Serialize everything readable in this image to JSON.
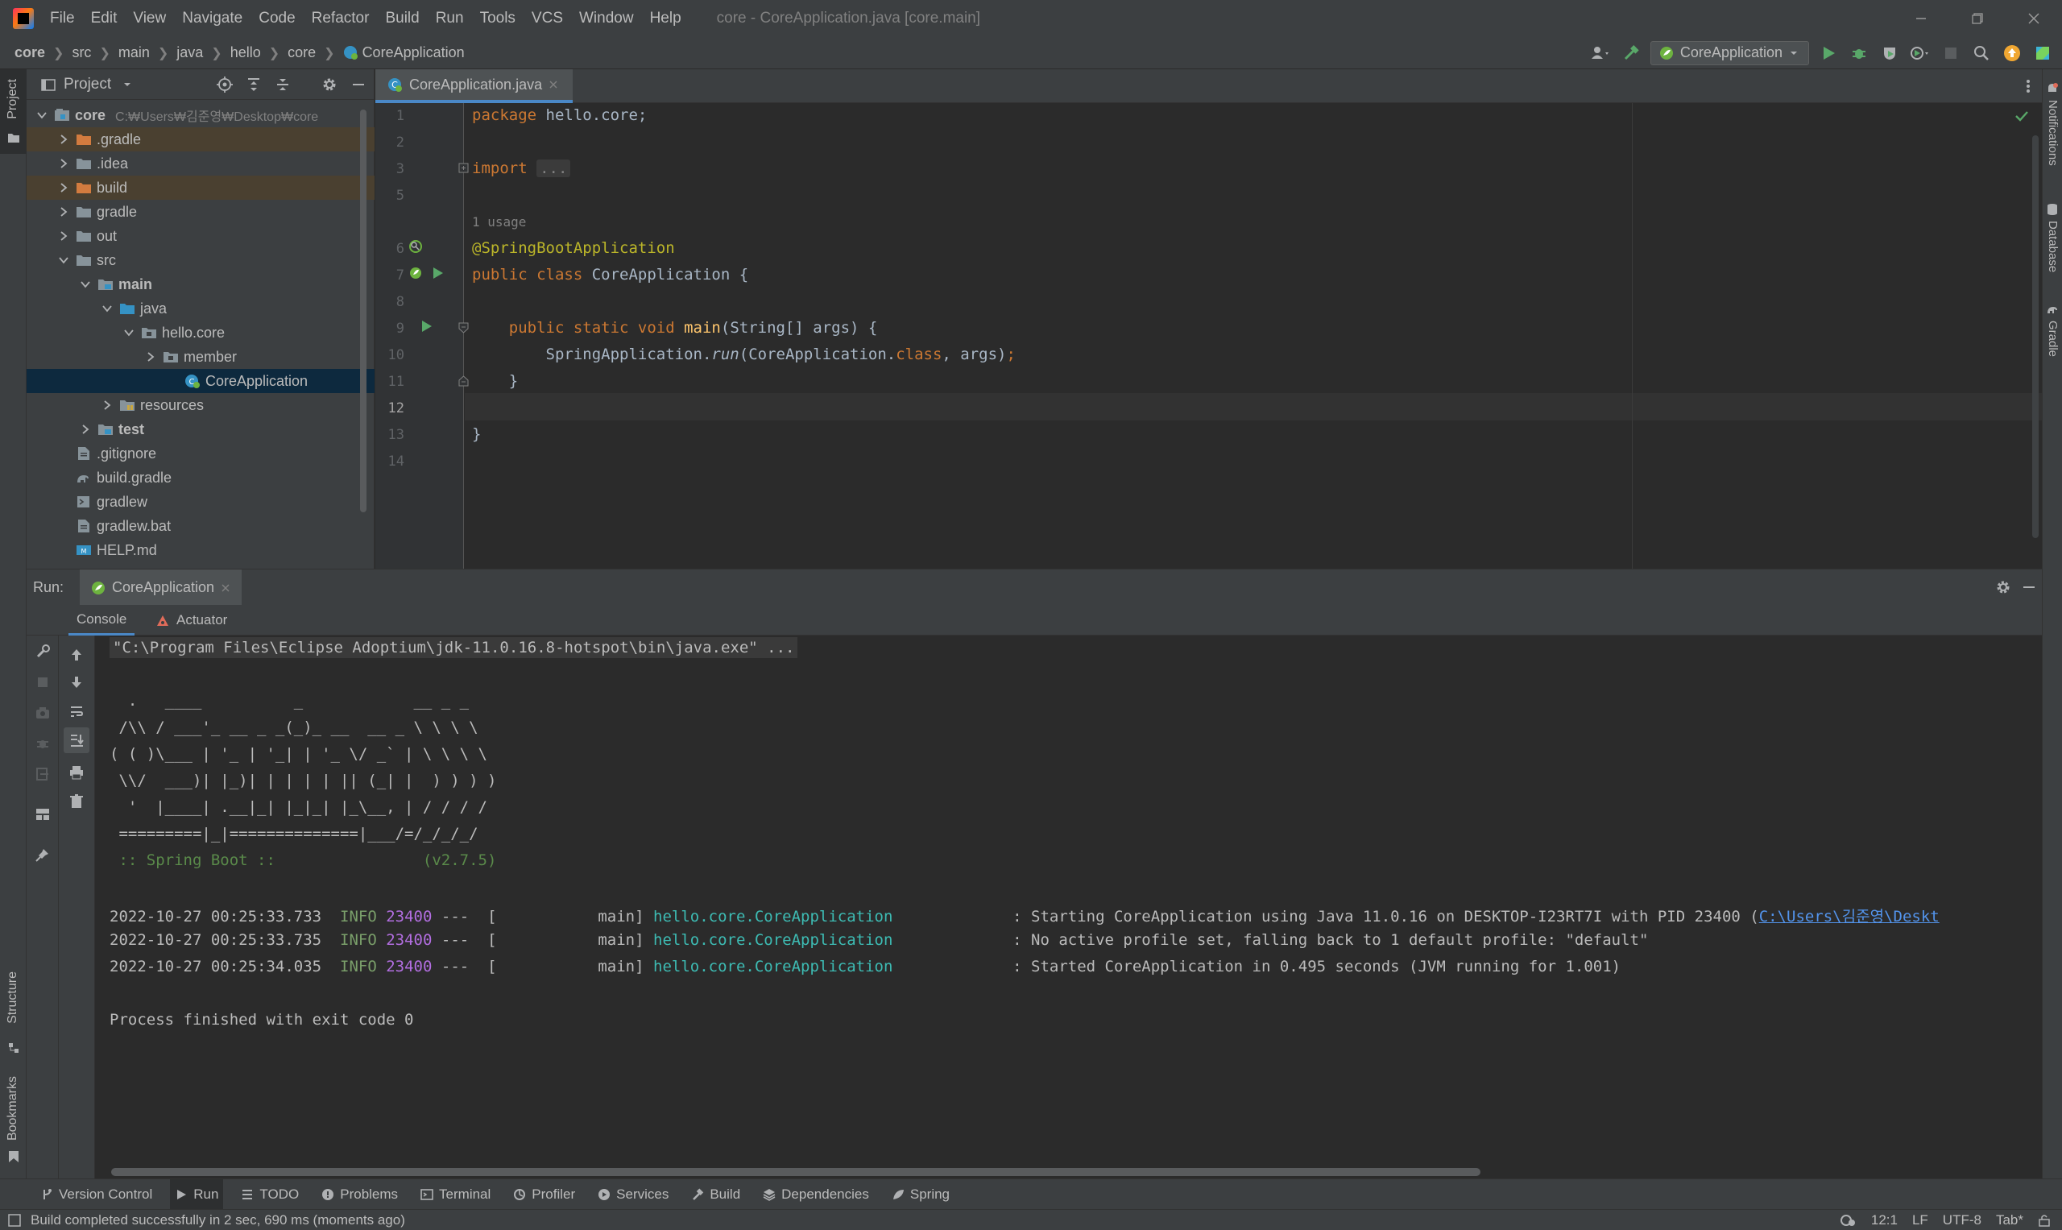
{
  "menubar": {
    "items": [
      "File",
      "Edit",
      "View",
      "Navigate",
      "Code",
      "Refactor",
      "Build",
      "Run",
      "Tools",
      "VCS",
      "Window",
      "Help"
    ],
    "window_title": "core - CoreApplication.java [core.main]"
  },
  "breadcrumb": [
    "core",
    "src",
    "main",
    "java",
    "hello",
    "core",
    "CoreApplication"
  ],
  "toolbar": {
    "run_config": "CoreApplication"
  },
  "project_panel": {
    "title": "Project",
    "tree": [
      {
        "label": "core",
        "path": "C:₩Users₩김준영₩Desktop₩core",
        "depth": 0,
        "type": "module",
        "expanded": true,
        "bold": true
      },
      {
        "label": ".gradle",
        "depth": 1,
        "type": "folder-orange",
        "expanded": false,
        "hl": true
      },
      {
        "label": ".idea",
        "depth": 1,
        "type": "folder",
        "expanded": false
      },
      {
        "label": "build",
        "depth": 1,
        "type": "folder-orange",
        "expanded": false,
        "hl": true
      },
      {
        "label": "gradle",
        "depth": 1,
        "type": "folder",
        "expanded": false
      },
      {
        "label": "out",
        "depth": 1,
        "type": "folder",
        "expanded": false
      },
      {
        "label": "src",
        "depth": 1,
        "type": "folder",
        "expanded": true
      },
      {
        "label": "main",
        "depth": 2,
        "type": "folder-src",
        "expanded": true,
        "bold": true
      },
      {
        "label": "java",
        "depth": 3,
        "type": "folder-blue",
        "expanded": true
      },
      {
        "label": "hello.core",
        "depth": 4,
        "type": "package",
        "expanded": true
      },
      {
        "label": "member",
        "depth": 5,
        "type": "package",
        "expanded": false
      },
      {
        "label": "CoreApplication",
        "depth": 6,
        "type": "spring-class",
        "selected": true
      },
      {
        "label": "resources",
        "depth": 3,
        "type": "folder-res",
        "expanded": false
      },
      {
        "label": "test",
        "depth": 2,
        "type": "folder-src",
        "expanded": false,
        "bold": true
      },
      {
        "label": ".gitignore",
        "depth": 1,
        "type": "file"
      },
      {
        "label": "build.gradle",
        "depth": 1,
        "type": "gradle"
      },
      {
        "label": "gradlew",
        "depth": 1,
        "type": "file-exec"
      },
      {
        "label": "gradlew.bat",
        "depth": 1,
        "type": "file"
      },
      {
        "label": "HELP.md",
        "depth": 1,
        "type": "md"
      }
    ]
  },
  "editor": {
    "tab_label": "CoreApplication.java",
    "line_numbers": [
      "1",
      "2",
      "3",
      "5",
      "6",
      "7",
      "8",
      "9",
      "10",
      "11",
      "12",
      "13",
      "14"
    ],
    "usage_hint": "1 usage",
    "current_line": "12"
  },
  "run_panel": {
    "label": "Run:",
    "tab": "CoreApplication",
    "subtabs": [
      "Console",
      "Actuator"
    ],
    "command": "\"C:\\Program Files\\Eclipse Adoptium\\jdk-11.0.16.8-hotspot\\bin\\java.exe\" ...",
    "banner": [
      "  .   ____          _            __ _ _",
      " /\\\\ / ___'_ __ _ _(_)_ __  __ _ \\ \\ \\ \\",
      "( ( )\\___ | '_ | '_| | '_ \\/ _` | \\ \\ \\ \\",
      " \\\\/  ___)| |_)| | | | | || (_| |  ) ) ) )",
      "  '  |____| .__|_| |_|_| |_\\__, | / / / /",
      " =========|_|==============|___/=/_/_/_/"
    ],
    "spring_line": " :: Spring Boot ::                (v2.7.5)",
    "logs": [
      {
        "ts": "2022-10-27 00:25:33.733",
        "level": "INFO",
        "pid": "23400",
        "thread": "---  [           main]",
        "logger": "hello.core.CoreApplication",
        "msg": ": Starting CoreApplication using Java 11.0.16 on DESKTOP-I23RT7I with PID 23400 (",
        "link": "C:\\Users\\김준영\\Deskt"
      },
      {
        "ts": "2022-10-27 00:25:33.735",
        "level": "INFO",
        "pid": "23400",
        "thread": "---  [           main]",
        "logger": "hello.core.CoreApplication",
        "msg": ": No active profile set, falling back to 1 default profile: \"default\"",
        "link": ""
      },
      {
        "ts": "2022-10-27 00:25:34.035",
        "level": "INFO",
        "pid": "23400",
        "thread": "---  [           main]",
        "logger": "hello.core.CoreApplication",
        "msg": ": Started CoreApplication in 0.495 seconds (JVM running for 1.001)",
        "link": ""
      }
    ],
    "exit": "Process finished with exit code 0"
  },
  "bottom_tools": [
    "Version Control",
    "Run",
    "TODO",
    "Problems",
    "Terminal",
    "Profiler",
    "Services",
    "Build",
    "Dependencies",
    "Spring"
  ],
  "left_stripe": {
    "top": "Project",
    "structure": "Structure",
    "bookmarks": "Bookmarks"
  },
  "right_stripe": [
    "Notifications",
    "Database",
    "Gradle"
  ],
  "status": {
    "message": "Build completed successfully in 2 sec, 690 ms (moments ago)",
    "position": "12:1",
    "line_sep": "LF",
    "encoding": "UTF-8",
    "indent": "Tab*"
  },
  "colors": {
    "accent": "#4a88c7",
    "selection": "#0d293e",
    "keyword": "#cc7832",
    "annotation": "#bbb529",
    "method": "#ffc66d",
    "logger": "#3dbbb3",
    "pid": "#b26ee0"
  }
}
